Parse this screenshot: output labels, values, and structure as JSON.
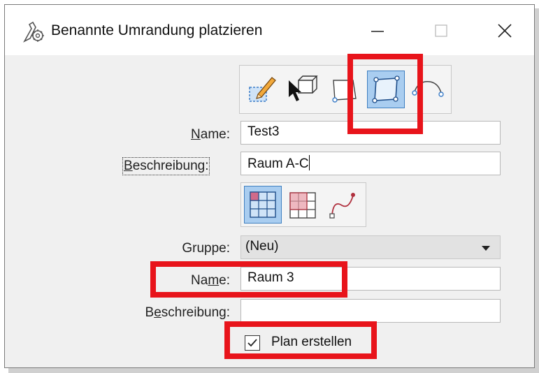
{
  "window": {
    "title": "Benannte Umrandung platzieren",
    "controls": {
      "minimize": "–",
      "maximize": "□",
      "close": "✕"
    }
  },
  "placement_tools": [
    {
      "name": "Element",
      "icon": "pencil-select-icon"
    },
    {
      "name": "Flood",
      "icon": "cursor-cube-icon"
    },
    {
      "name": "Shape",
      "icon": "shape-icon"
    },
    {
      "name": "Rectangle",
      "icon": "rectangle-icon",
      "active": true
    },
    {
      "name": "Path",
      "icon": "path-icon"
    }
  ],
  "name_row": {
    "label_prefix": "",
    "label_mnemonic": "N",
    "label_rest": "ame:",
    "value": "Test3"
  },
  "description_row": {
    "label_prefix": "",
    "label_mnemonic": "B",
    "label_rest": "eschreibung:",
    "value": "Raum A-C"
  },
  "grid_tools": [
    {
      "name": "Gitter",
      "icon": "grid-blue-icon",
      "active": true
    },
    {
      "name": "Gitter rot",
      "icon": "grid-red-icon"
    },
    {
      "name": "Kurve",
      "icon": "curve-icon"
    }
  ],
  "group_row": {
    "label": "Gruppe:",
    "selected": "(Neu)"
  },
  "group_name_row": {
    "label_prefix": "Na",
    "label_mnemonic": "m",
    "label_rest": "e:",
    "value": "Raum 3"
  },
  "group_description_row": {
    "label_prefix": "B",
    "label_mnemonic": "e",
    "label_rest": "schreibung:",
    "value": ""
  },
  "checkbox": {
    "label": "Plan erstellen",
    "checked": true
  },
  "colors": {
    "highlight": "#e8141b",
    "active_tool": "#a9cdf0"
  }
}
